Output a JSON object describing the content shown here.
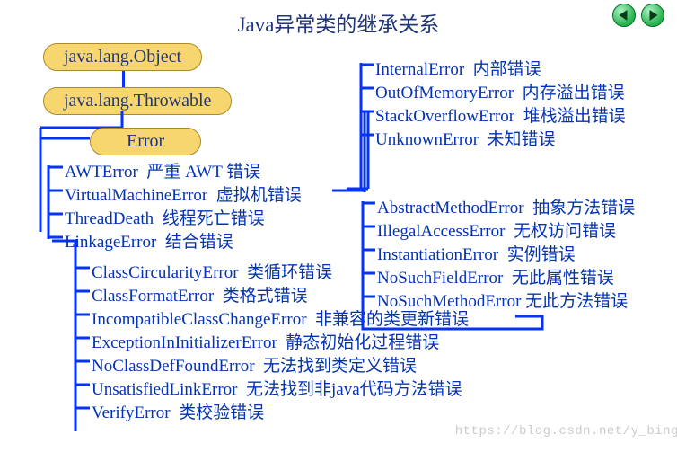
{
  "title": "Java异常类的继承关系",
  "root": {
    "object": "java.lang.Object",
    "throwable": "java.lang.Throwable",
    "error": "Error"
  },
  "leftA": [
    {
      "en": "AWTError",
      "zh": "严重 AWT 错误"
    },
    {
      "en": "VirtualMachineError",
      "zh": "虚拟机错误"
    },
    {
      "en": "ThreadDeath",
      "zh": "线程死亡错误"
    },
    {
      "en": "LinkageError",
      "zh": "结合错误"
    }
  ],
  "rightA": [
    {
      "en": "InternalError",
      "zh": "内部错误"
    },
    {
      "en": "OutOfMemoryError",
      "zh": "内存溢出错误"
    },
    {
      "en": "StackOverflowError",
      "zh": "堆栈溢出错误"
    },
    {
      "en": "UnknownError",
      "zh": "未知错误"
    }
  ],
  "leftB": [
    {
      "en": "ClassCircularityError",
      "zh": "类循环错误"
    },
    {
      "en": "ClassFormatError",
      "zh": "类格式错误"
    },
    {
      "en": "IncompatibleClassChangeError",
      "zh": "非兼容的类更新错误"
    },
    {
      "en": "ExceptionInInitializerError",
      "zh": "静态初始化过程错误"
    },
    {
      "en": "NoClassDefFoundError",
      "zh": "无法找到类定义错误"
    },
    {
      "en": "UnsatisfiedLinkError",
      "zh": "无法找到非java代码方法错误"
    },
    {
      "en": "VerifyError",
      "zh": "类校验错误"
    }
  ],
  "rightB": [
    {
      "en": "AbstractMethodError",
      "zh": "抽象方法错误"
    },
    {
      "en": "IllegalAccessError",
      "zh": "无权访问错误"
    },
    {
      "en": "InstantiationError",
      "zh": "实例错误"
    },
    {
      "en": "NoSuchFieldError",
      "zh": "无此属性错误"
    },
    {
      "en": "NoSuchMethodError",
      "zh": "无此方法错误"
    }
  ],
  "watermark": "https://blog.csdn.net/y_bing"
}
